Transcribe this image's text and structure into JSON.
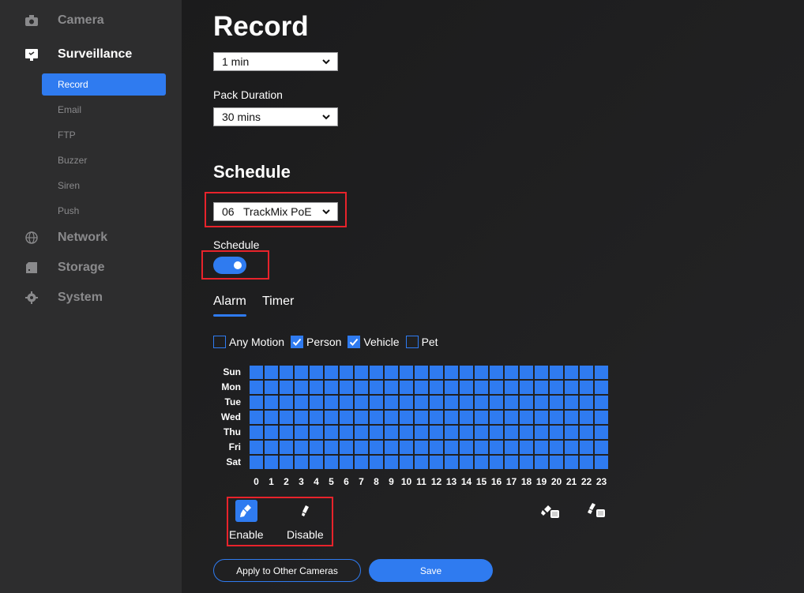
{
  "sidebar": {
    "groups": [
      {
        "label": "Camera",
        "icon": "camera-icon"
      },
      {
        "label": "Surveillance",
        "icon": "monitor-icon"
      },
      {
        "label": "Network",
        "icon": "globe-icon"
      },
      {
        "label": "Storage",
        "icon": "storage-icon"
      },
      {
        "label": "System",
        "icon": "gear-icon"
      }
    ],
    "sub_items": [
      "Record",
      "Email",
      "FTP",
      "Buzzer",
      "Siren",
      "Push"
    ],
    "active_sub": "Record"
  },
  "main": {
    "title": "Record",
    "post_record": {
      "value": "1 min"
    },
    "pack_duration": {
      "label": "Pack Duration",
      "value": "30 mins"
    },
    "schedule_heading": "Schedule",
    "camera_select": {
      "value": "06   TrackMix PoE"
    },
    "schedule_toggle": {
      "label": "Schedule",
      "on": true
    },
    "tabs": [
      "Alarm",
      "Timer"
    ],
    "active_tab": "Alarm",
    "alarm_types": [
      {
        "label": "Any Motion",
        "checked": false
      },
      {
        "label": "Person",
        "checked": true
      },
      {
        "label": "Vehicle",
        "checked": true
      },
      {
        "label": "Pet",
        "checked": false
      }
    ],
    "days": [
      "Sun",
      "Mon",
      "Tue",
      "Wed",
      "Thu",
      "Fri",
      "Sat"
    ],
    "hours": [
      "0",
      "1",
      "2",
      "3",
      "4",
      "5",
      "6",
      "7",
      "8",
      "9",
      "10",
      "11",
      "12",
      "13",
      "14",
      "15",
      "16",
      "17",
      "18",
      "19",
      "20",
      "21",
      "22",
      "23"
    ],
    "tools": {
      "enable_label": "Enable",
      "disable_label": "Disable"
    },
    "buttons": {
      "apply_label": "Apply to Other Cameras",
      "save_label": "Save"
    }
  },
  "colors": {
    "accent": "#2f7bf0",
    "highlight": "#e8232b",
    "sidebar_bg": "#2d2d2e"
  }
}
